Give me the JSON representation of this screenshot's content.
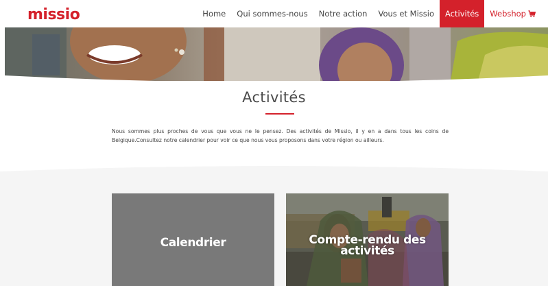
{
  "brand": {
    "logo_text": "missio"
  },
  "colors": {
    "brand_red": "#d4212b",
    "card_grey": "#797979",
    "band_grey": "#f5f5f5"
  },
  "nav": {
    "items": [
      {
        "label": "Home"
      },
      {
        "label": "Qui sommes-nous"
      },
      {
        "label": "Notre action"
      },
      {
        "label": "Vous et Missio"
      },
      {
        "label": "Activités",
        "active": true
      }
    ],
    "webshop_label": "Webshop",
    "webshop_icon": "cart-icon"
  },
  "page": {
    "title": "Activités",
    "intro": "Nous sommes plus proches de vous que vous ne le pensez. Des activités de Missio, il y en a dans tous les coins de Belgique.Consultez notre calendrier pour voir ce que nous vous proposons dans votre région ou ailleurs."
  },
  "cards": {
    "calendar_label": "Calendrier",
    "report_label": "Compte-rendu des activités"
  }
}
